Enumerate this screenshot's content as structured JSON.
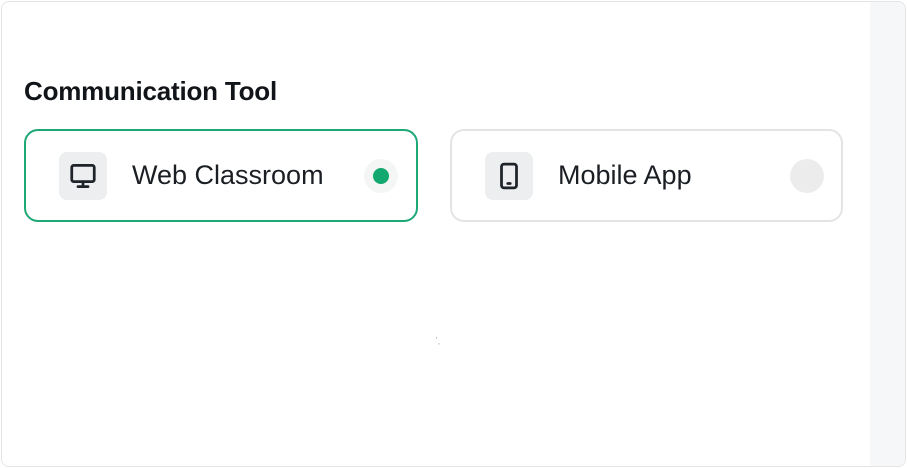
{
  "section": {
    "title": "Communication Tool"
  },
  "options": [
    {
      "label": "Web Classroom",
      "icon": "monitor-icon",
      "selected": true
    },
    {
      "label": "Mobile App",
      "icon": "mobile-phone-icon",
      "selected": false
    }
  ],
  "colors": {
    "accent": "#12a86e",
    "selected_border": "#1ea876",
    "card_border": "#e3e4e6",
    "icon_tile": "#eceef0"
  }
}
